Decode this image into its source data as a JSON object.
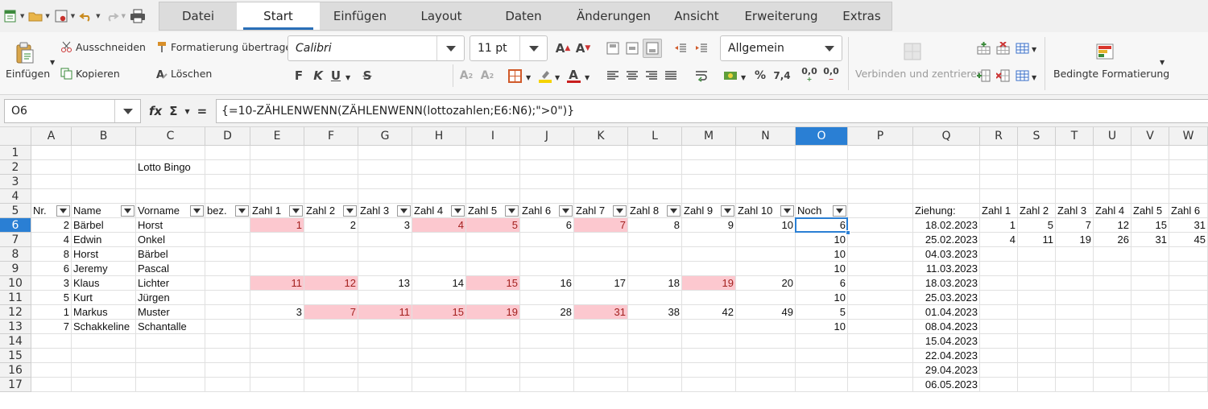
{
  "tabs": [
    "Datei",
    "Start",
    "Einfügen",
    "Layout",
    "Daten",
    "Änderungen",
    "Ansicht",
    "Erweiterung",
    "Extras"
  ],
  "active_tab": "Start",
  "ribbon": {
    "paste_label": "Einfügen",
    "cut_label": "Ausschneiden",
    "copy_label": "Kopieren",
    "format_paint_label": "Formatierung übertragen",
    "clear_label": "Löschen",
    "font_name": "Calibri",
    "font_size": "11 pt",
    "number_format": "Allgemein",
    "merge_label": "Verbinden und zentrieren",
    "cond_format_label": "Bedingte Formatierung",
    "bold_glyph": "F",
    "italic_glyph": "K",
    "underline_glyph": "U",
    "strike_glyph": "S",
    "grow_glyph": "A",
    "shrink_glyph": "A",
    "percent_glyph": "%",
    "thousands_glyph": "7,4",
    "dec_add_glyph": "0,0",
    "dec_remove_glyph": "0,0"
  },
  "formula_bar": {
    "cell_ref": "O6",
    "fx_glyph": "fx",
    "sum_glyph": "Σ",
    "equals_glyph": "=",
    "formula": "{=10-ZÄHLENWENN(ZÄHLENWENN(lottozahlen;E6:N6);\">0\")}"
  },
  "sheet": {
    "columns": [
      "A",
      "B",
      "C",
      "D",
      "E",
      "F",
      "G",
      "H",
      "I",
      "J",
      "K",
      "L",
      "M",
      "N",
      "O",
      "P",
      "Q",
      "R",
      "S",
      "T",
      "U",
      "V",
      "W"
    ],
    "selected_column": "O",
    "rows": [
      "1",
      "2",
      "3",
      "4",
      "5",
      "6",
      "7",
      "8",
      "9",
      "10",
      "11",
      "12",
      "13",
      "14",
      "15",
      "16",
      "17"
    ],
    "selected_row": "6",
    "title": "Lotto Bingo",
    "headers": [
      "Nr.",
      "Name",
      "Vorname",
      "bez.",
      "Zahl 1",
      "Zahl 2",
      "Zahl 3",
      "Zahl 4",
      "Zahl 5",
      "Zahl 6",
      "Zahl 7",
      "Zahl 8",
      "Zahl 9",
      "Zahl 10",
      "Noch"
    ],
    "players": [
      {
        "nr": 2,
        "name": "Bärbel",
        "vorname": "Horst",
        "zahlen": [
          1,
          2,
          3,
          4,
          5,
          6,
          7,
          8,
          9,
          10
        ],
        "hit": [
          1,
          0,
          0,
          1,
          1,
          0,
          1,
          0,
          0,
          0
        ],
        "noch": 6
      },
      {
        "nr": 4,
        "name": "Edwin",
        "vorname": "Onkel",
        "zahlen": [],
        "hit": [],
        "noch": 10
      },
      {
        "nr": 8,
        "name": "Horst",
        "vorname": "Bärbel",
        "zahlen": [],
        "hit": [],
        "noch": 10
      },
      {
        "nr": 6,
        "name": "Jeremy",
        "vorname": "Pascal",
        "zahlen": [],
        "hit": [],
        "noch": 10
      },
      {
        "nr": 3,
        "name": "Klaus",
        "vorname": "Lichter",
        "zahlen": [
          11,
          12,
          13,
          14,
          15,
          16,
          17,
          18,
          19,
          20
        ],
        "hit": [
          1,
          1,
          0,
          0,
          1,
          0,
          0,
          0,
          1,
          0
        ],
        "noch": 6
      },
      {
        "nr": 5,
        "name": "Kurt",
        "vorname": "Jürgen",
        "zahlen": [],
        "hit": [],
        "noch": 10
      },
      {
        "nr": 1,
        "name": "Markus",
        "vorname": "Muster",
        "zahlen": [
          3,
          7,
          11,
          15,
          19,
          28,
          31,
          38,
          42,
          49
        ],
        "hit": [
          0,
          1,
          1,
          1,
          1,
          0,
          1,
          0,
          0,
          0
        ],
        "noch": 5
      },
      {
        "nr": 7,
        "name": "Schakkeline",
        "vorname": "Schantalle",
        "zahlen": [],
        "hit": [],
        "noch": 10
      }
    ],
    "draw_header": [
      "Ziehung:",
      "Zahl 1",
      "Zahl 2",
      "Zahl 3",
      "Zahl 4",
      "Zahl 5",
      "Zahl 6"
    ],
    "draws": [
      {
        "date": "18.02.2023",
        "zahlen": [
          1,
          5,
          7,
          12,
          15,
          31
        ]
      },
      {
        "date": "25.02.2023",
        "zahlen": [
          4,
          11,
          19,
          26,
          31,
          45
        ]
      },
      {
        "date": "04.03.2023",
        "zahlen": []
      },
      {
        "date": "11.03.2023",
        "zahlen": []
      },
      {
        "date": "18.03.2023",
        "zahlen": []
      },
      {
        "date": "25.03.2023",
        "zahlen": []
      },
      {
        "date": "01.04.2023",
        "zahlen": []
      },
      {
        "date": "08.04.2023",
        "zahlen": []
      },
      {
        "date": "15.04.2023",
        "zahlen": []
      },
      {
        "date": "22.04.2023",
        "zahlen": []
      },
      {
        "date": "29.04.2023",
        "zahlen": []
      },
      {
        "date": "06.05.2023",
        "zahlen": []
      }
    ]
  },
  "colors": {
    "accent": "#2a7fd4",
    "highlight_fill": "#fcc8cf",
    "highlight_text": "#a3201e"
  }
}
